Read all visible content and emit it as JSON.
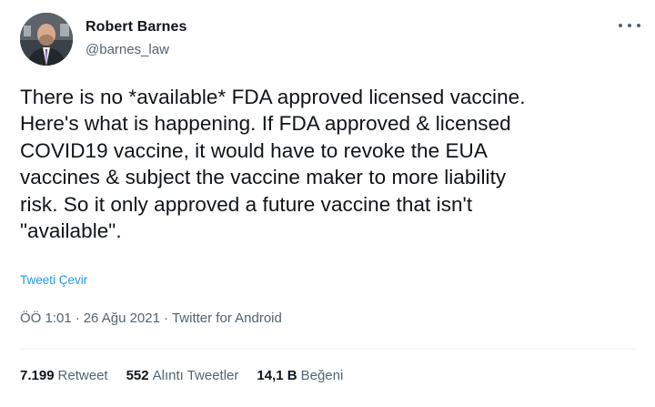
{
  "user": {
    "name": "Robert Barnes",
    "handle": "@barnes_law"
  },
  "tweet": {
    "text": "There is no *available* FDA approved licensed vaccine.\nHere's what is happening. If FDA approved & licensed\nCOVID19 vaccine, it would have to revoke the EUA\nvaccines & subject the vaccine maker to more liability\nrisk. So it only approved a future vaccine that isn't\n\"available\".",
    "translate_label": "Tweeti Çevir"
  },
  "meta": {
    "time": "ÖÖ 1:01",
    "date": "26 Ağu 2021",
    "source": "Twitter for Android",
    "separator": "·"
  },
  "stats": {
    "retweets": {
      "count": "7.199",
      "label": "Retweet"
    },
    "quotes": {
      "count": "552",
      "label": "Alıntı Tweetler"
    },
    "likes": {
      "count": "14,1 B",
      "label": "Beğeni"
    }
  },
  "colors": {
    "link": "#1d9bf0",
    "secondary_text": "#536471",
    "primary_text": "#0f1419"
  },
  "icons": {
    "more": "more-options-icon",
    "avatar": "profile-photo"
  }
}
